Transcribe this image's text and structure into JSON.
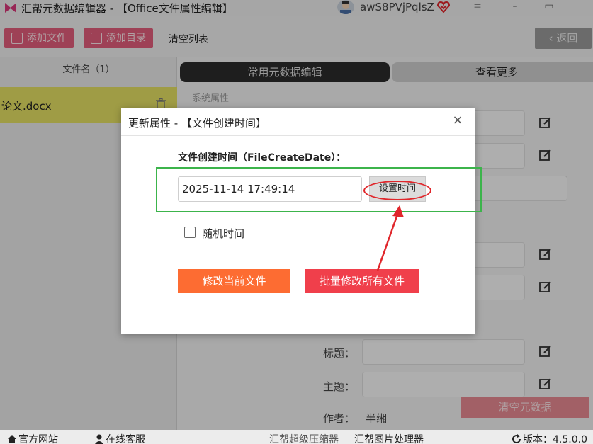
{
  "window": {
    "title": "汇帮元数据编辑器 - 【Office文件属性编辑】",
    "user_name": "awS8PVjPqlsZ",
    "menu_icon": "hamburger-icon",
    "minimize_icon": "minimize-icon",
    "maximize_icon": "maximize-icon"
  },
  "toolbar": {
    "add_file": "添加文件",
    "add_folder": "添加目录",
    "clear_list": "清空列表",
    "back": "返回"
  },
  "file_list": {
    "header": "文件名（1）",
    "files": [
      {
        "name": "论文.docx"
      }
    ]
  },
  "tabs": {
    "common": "常用元数据编辑",
    "more": "查看更多"
  },
  "properties": {
    "section_system": "系统属性",
    "title_label": "标题：",
    "subject_label": "主题：",
    "author_label": "作者：",
    "author_value": "半缃",
    "clear_metadata": "清空元数据"
  },
  "dialog": {
    "title": "更新属性 - 【文件创建时间】",
    "close": "×",
    "field_label": "文件创建时间（FileCreateDate）：",
    "date_value": "2025-11-14 17:49:14",
    "set_time": "设置时间",
    "random_time": "随机时间",
    "random_checked": false,
    "modify_current": "修改当前文件",
    "modify_all": "批量修改所有文件"
  },
  "statusbar": {
    "website": "官方网站",
    "support": "在线客服",
    "compressor": "汇帮超级压缩器",
    "image_tool": "汇帮图片处理器",
    "version": "版本：4.5.0.0"
  },
  "colors": {
    "accent_pink": "#e35d7b",
    "file_highlight": "#e4e063",
    "btn_orange": "#fd6c32",
    "btn_red": "#f03f4b",
    "annotation_green": "#3cb44b",
    "annotation_red": "#e0262b"
  }
}
